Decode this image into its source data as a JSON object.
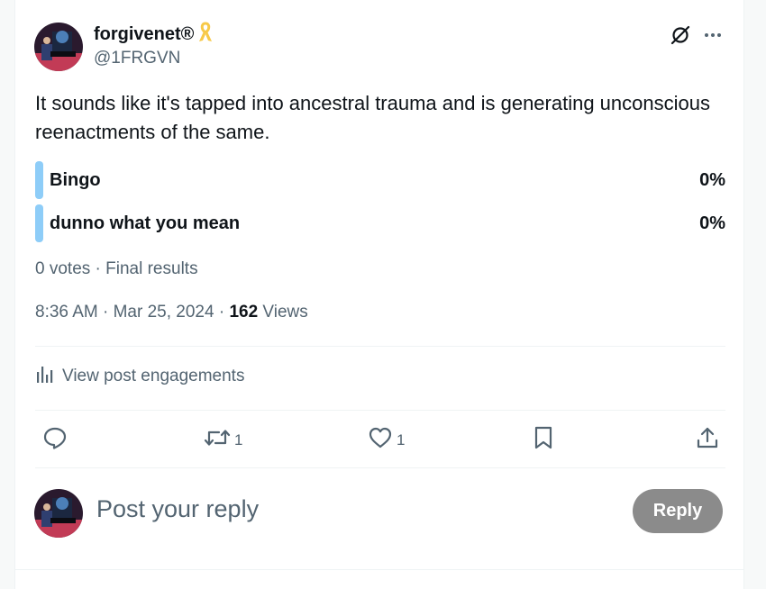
{
  "author": {
    "name": "forgivenet®",
    "handle": "@1FRGVN"
  },
  "post": {
    "text": "It sounds like it's tapped into ancestral trauma and is generating unconscious reenactments of the same."
  },
  "poll": {
    "options": [
      {
        "label": "Bingo",
        "percent": "0%"
      },
      {
        "label": "dunno what you mean",
        "percent": "0%"
      }
    ],
    "summary": "0 votes · Final results"
  },
  "timestamp": {
    "time_date": "8:36 AM · Mar 25, 2024 · ",
    "views_count": "162",
    "views_label": " Views"
  },
  "engagements_label": "View post engagements",
  "actions": {
    "retweet_count": "1",
    "like_count": "1"
  },
  "reply_box": {
    "placeholder": "Post your reply",
    "button_label": "Reply"
  },
  "icons": [
    "avatar",
    "ribbon-icon",
    "grok-icon",
    "more-icon",
    "analytics-icon",
    "reply-icon",
    "retweet-icon",
    "like-icon",
    "bookmark-icon",
    "share-icon"
  ],
  "colors": {
    "poll_bar": "#8ecdf8",
    "secondary_text": "#536471",
    "reply_button": "#8b8b8b",
    "ribbon": "#f7c948"
  }
}
